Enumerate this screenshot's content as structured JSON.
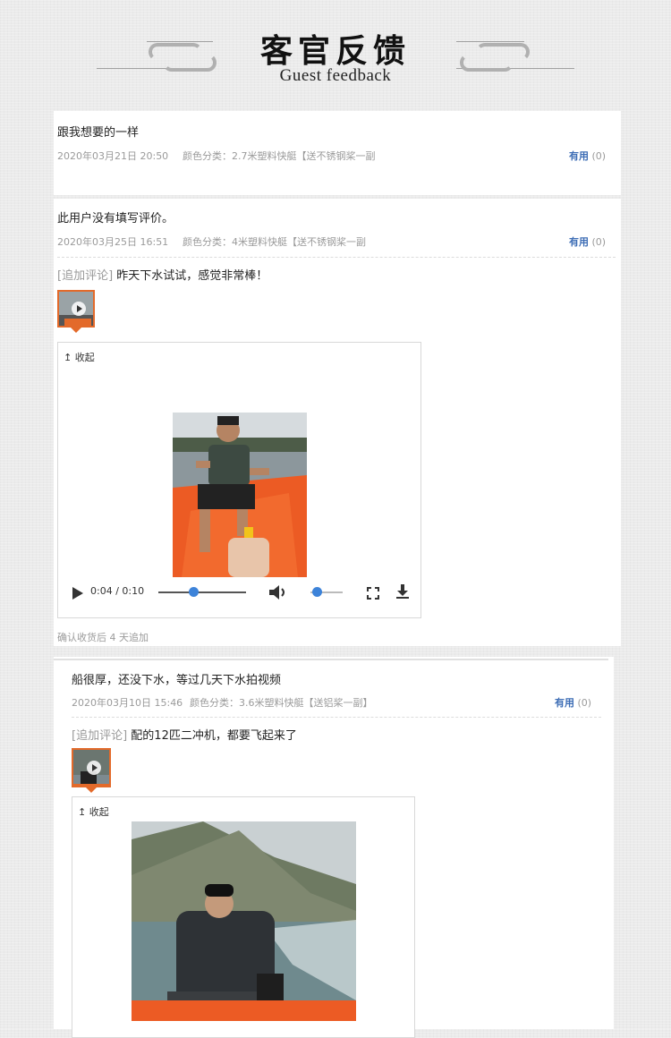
{
  "header": {
    "title_cn": "客官反馈",
    "title_en": "Guest feedback"
  },
  "colors": {
    "accent_orange": "#e36a2a",
    "useful_blue": "#3d6db5",
    "slider_blue": "#3d83d9"
  },
  "reviews": [
    {
      "text": "跟我想要的一样",
      "date": "2020年03月21日 20:50",
      "sku": "颜色分类：2.7米塑料快艇【送不锈钢桨一副",
      "useful_label": "有用",
      "useful_count": "(0)"
    },
    {
      "text": "此用户没有填写评价。",
      "date": "2020年03月25日 16:51",
      "sku": "颜色分类：4米塑料快艇【送不锈钢桨一副",
      "useful_label": "有用",
      "useful_count": "(0)",
      "append_tag": "[追加评论]",
      "append_text": "昨天下水试试，感觉非常棒！",
      "collapse_label": "↥ 收起",
      "player_time": "0:04 / 0:10",
      "progress": 0.4,
      "volume": 0.2,
      "footnote": "确认收货后 4 天追加"
    },
    {
      "text": "船很厚，还没下水，等过几天下水拍视频",
      "date": "2020年03月10日 15:46",
      "sku": "颜色分类：3.6米塑料快艇【送铝桨一副】",
      "useful_label": "有用",
      "useful_count": "(0)",
      "append_tag": "[追加评论]",
      "append_text": "配的12匹二冲机，都要飞起来了",
      "collapse_label": "↥ 收起"
    }
  ]
}
